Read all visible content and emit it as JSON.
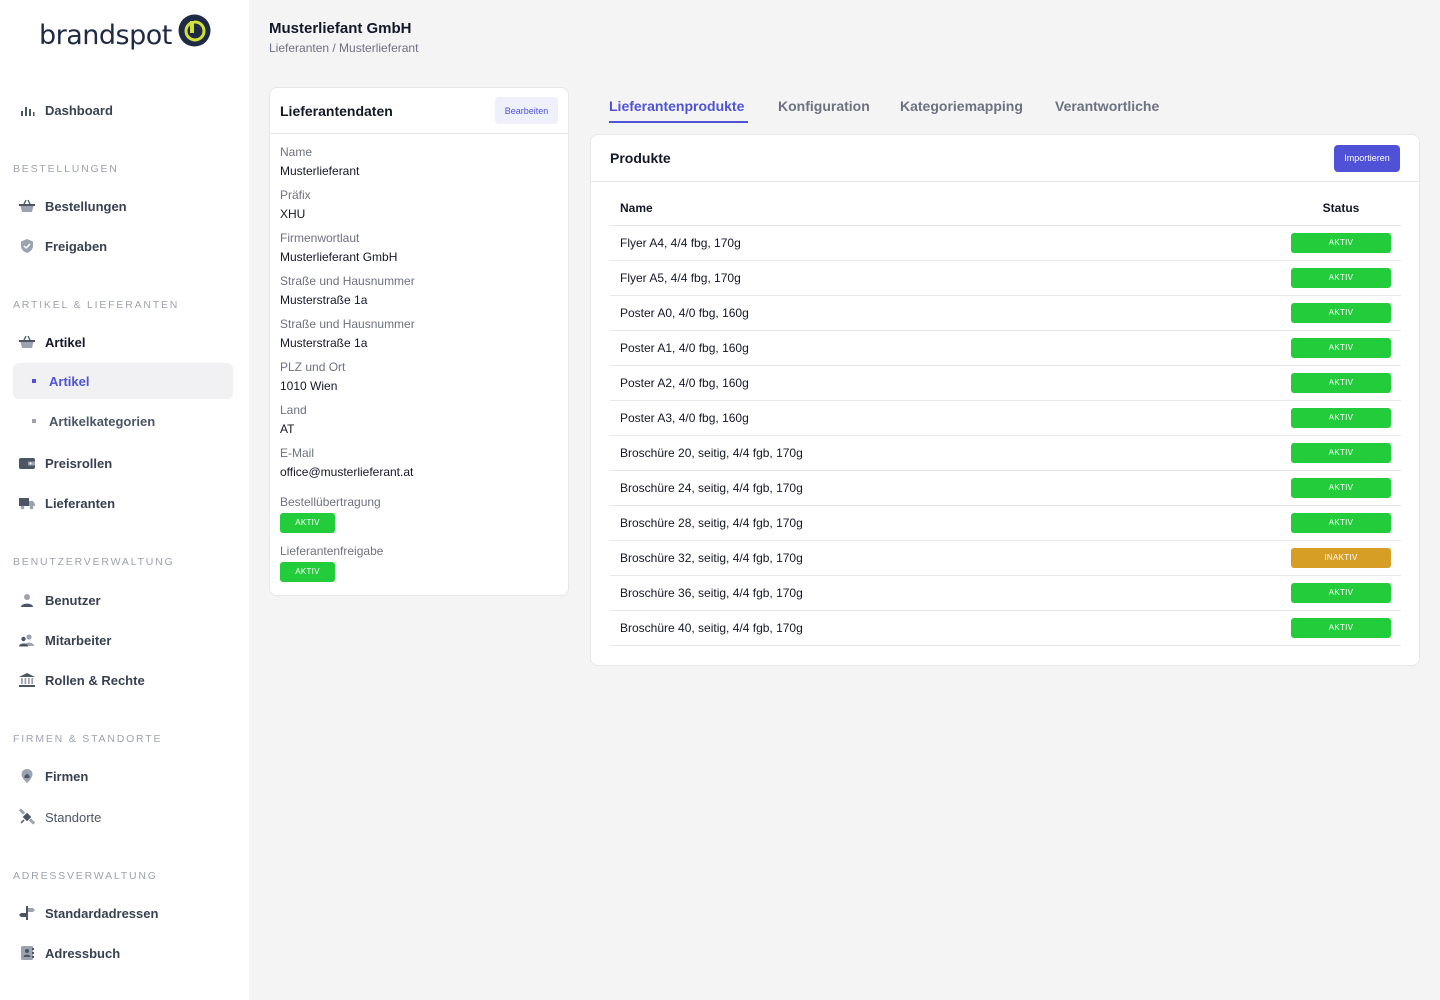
{
  "app": {
    "logo_text": "brandspot"
  },
  "sidebar": {
    "dashboard": "Dashboard",
    "sections": {
      "orders": "BESTELLUNGEN",
      "articles": "ARTIKEL & LIEFERANTEN",
      "users": "BENUTZERVERWALTUNG",
      "companies": "FIRMEN & STANDORTE",
      "addresses": "ADRESSVERWALTUNG"
    },
    "items": {
      "orders": "Bestellungen",
      "approvals": "Freigaben",
      "articles": "Artikel",
      "articles_sub": "Artikel",
      "article_categories": "Artikelkategorien",
      "price_roles": "Preisrollen",
      "suppliers": "Lieferanten",
      "users": "Benutzer",
      "employees": "Mitarbeiter",
      "roles": "Rollen & Rechte",
      "companies": "Firmen",
      "locations": "Standorte",
      "default_addresses": "Standardadressen",
      "address_book": "Adressbuch"
    }
  },
  "header": {
    "title": "Musterliefant GmbH",
    "breadcrumb": "Lieferanten / Musterlieferant"
  },
  "supplier": {
    "card_title": "Lieferantendaten",
    "edit_label": "Bearbeiten",
    "fields": [
      {
        "label": "Name",
        "value": "Musterlieferant"
      },
      {
        "label": "Präfix",
        "value": "XHU"
      },
      {
        "label": "Firmenwortlaut",
        "value": "Musterlieferant GmbH"
      },
      {
        "label": "Straße und Hausnummer",
        "value": "Musterstraße 1a"
      },
      {
        "label": "Straße und Hausnummer",
        "value": "Musterstraße 1a"
      },
      {
        "label": "PLZ und Ort",
        "value": "1010 Wien"
      },
      {
        "label": "Land",
        "value": "AT"
      },
      {
        "label": "E-Mail",
        "value": "office@musterlieferant.at"
      }
    ],
    "order_transmission": {
      "label": "Bestellübertragung",
      "status": "AKTIV"
    },
    "supplier_approval": {
      "label": "Lieferantenfreigabe",
      "status": "AKTIV"
    }
  },
  "tabs": [
    "Lieferantenprodukte",
    "Konfiguration",
    "Kategoriemapping",
    "Verantwortliche"
  ],
  "products": {
    "title": "Produkte",
    "import_label": "Importieren",
    "columns": [
      "Name",
      "Status"
    ],
    "rows": [
      {
        "name": "Flyer A4, 4/4 fbg, 170g",
        "status": "AKTIV"
      },
      {
        "name": "Flyer A5, 4/4 fbg, 170g",
        "status": "AKTIV"
      },
      {
        "name": "Poster A0, 4/0 fbg, 160g",
        "status": "AKTIV"
      },
      {
        "name": "Poster A1, 4/0 fbg, 160g",
        "status": "AKTIV"
      },
      {
        "name": "Poster A2, 4/0 fbg, 160g",
        "status": "AKTIV"
      },
      {
        "name": "Poster A3, 4/0 fbg, 160g",
        "status": "AKTIV"
      },
      {
        "name": "Broschüre 20, seitig, 4/4 fgb, 170g",
        "status": "AKTIV"
      },
      {
        "name": "Broschüre 24, seitig, 4/4 fgb, 170g",
        "status": "AKTIV"
      },
      {
        "name": "Broschüre 28, seitig, 4/4 fgb, 170g",
        "status": "AKTIV"
      },
      {
        "name": "Broschüre 32, seitig, 4/4 fgb, 170g",
        "status": "INAKTIV"
      },
      {
        "name": "Broschüre 36, seitig, 4/4 fgb, 170g",
        "status": "AKTIV"
      },
      {
        "name": "Broschüre 40, seitig, 4/4 fgb, 170g",
        "status": "AKTIV"
      }
    ]
  },
  "colors": {
    "accent": "#4f52d6",
    "active": "#22cc3a",
    "inactive": "#d69e24"
  }
}
